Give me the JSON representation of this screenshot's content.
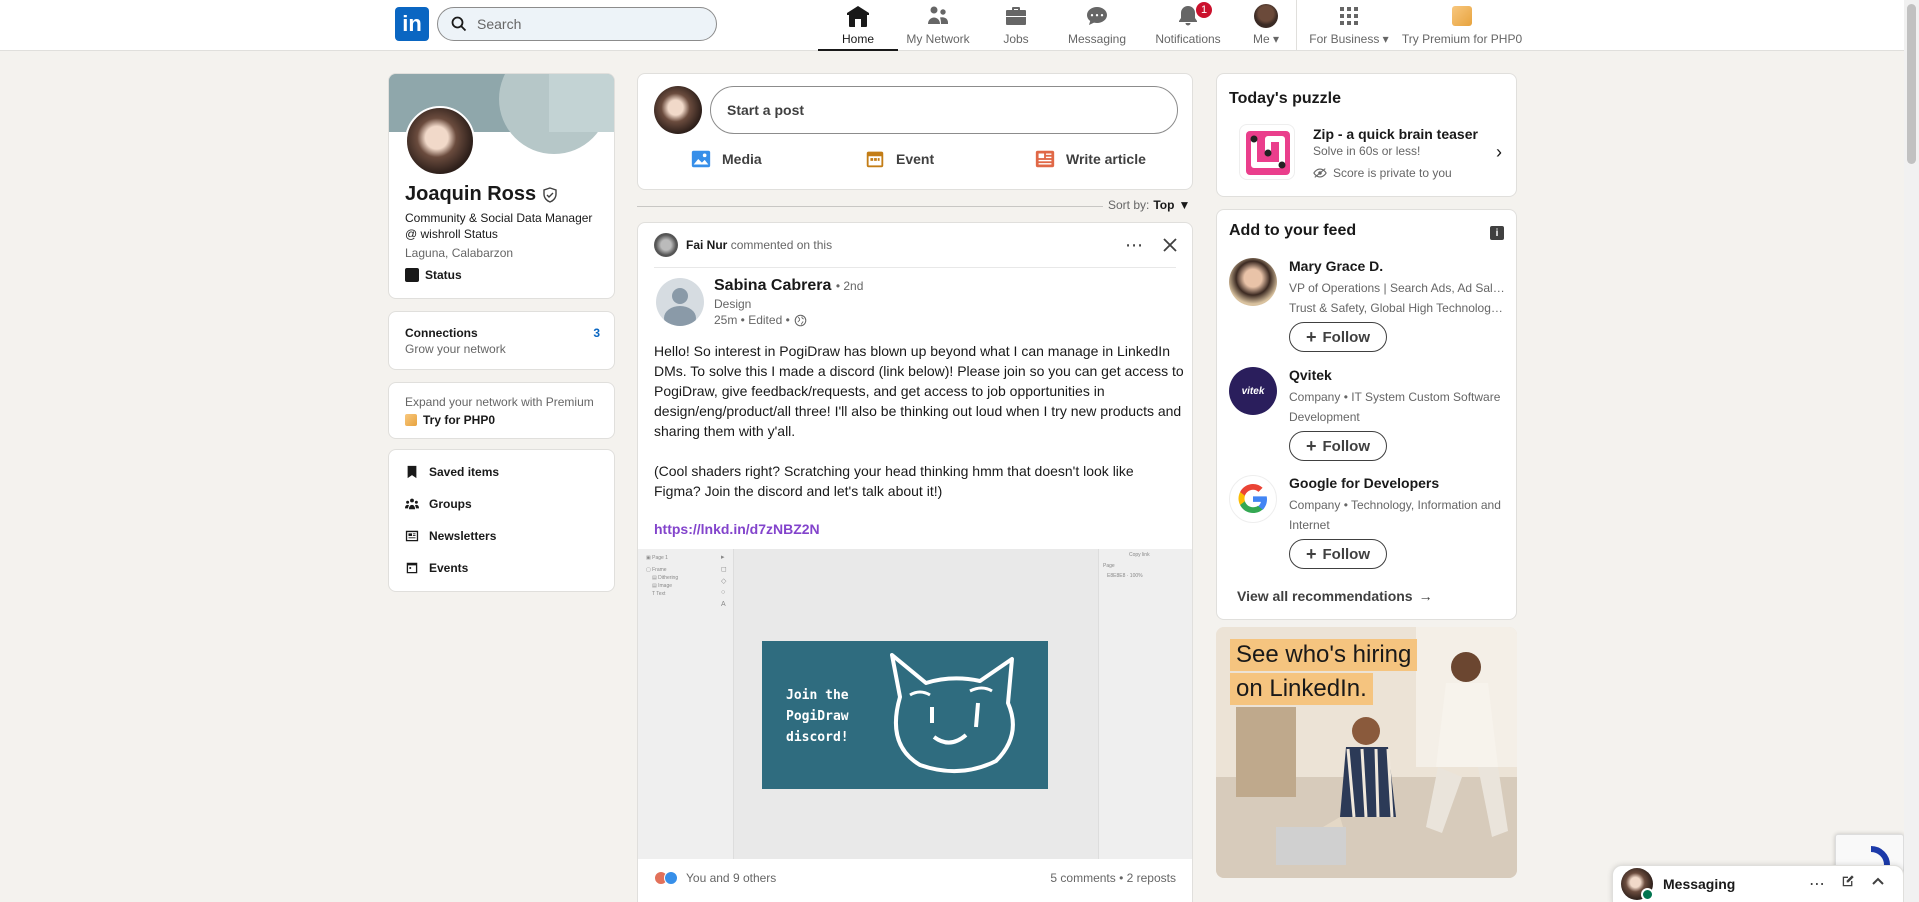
{
  "nav": {
    "logo": "in",
    "search_placeholder": "Search",
    "items": [
      {
        "label": "Home",
        "icon": "home-icon",
        "active": true
      },
      {
        "label": "My Network",
        "icon": "network-icon"
      },
      {
        "label": "Jobs",
        "icon": "briefcase-icon"
      },
      {
        "label": "Messaging",
        "icon": "messaging-icon"
      },
      {
        "label": "Notifications",
        "icon": "bell-icon",
        "badge": "1"
      },
      {
        "label": "Me",
        "icon": "avatar"
      },
      {
        "label": "For Business",
        "icon": "grid-icon"
      },
      {
        "label": "Try Premium for PHP0",
        "icon": "premium-icon"
      }
    ]
  },
  "profile": {
    "name": "Joaquin Ross",
    "headline": "Community & Social Data Manager @ wishroll Status",
    "location": "Laguna, Calabarzon",
    "status_label": "Status",
    "connections_label": "Connections",
    "connections_count": "3",
    "grow_network": "Grow your network",
    "premium_prompt": "Expand your network with Premium",
    "premium_cta": "Try for PHP0",
    "links": [
      "Saved items",
      "Groups",
      "Newsletters",
      "Events"
    ]
  },
  "composer": {
    "placeholder": "Start a post",
    "actions": [
      "Media",
      "Event",
      "Write article"
    ]
  },
  "sort": {
    "label": "Sort by:",
    "value": "Top"
  },
  "post": {
    "activity_actor": "Fai Nur",
    "activity_text": "commented on this",
    "author_name": "Sabina Cabrera",
    "author_degree": "• 2nd",
    "author_title": "Design",
    "time": "25m • Edited •",
    "body_1": "Hello! So interest in PogiDraw has blown up beyond what I can manage in LinkedIn DMs. To solve this I made a discord (link below)! Please join so you can get access to PogiDraw, give feedback/requests, and get access to job opportunities in design/eng/product/all three! I'll also be thinking out loud when I try new products and sharing them with y'all.",
    "body_2": "(Cool shaders right? Scratching your head thinking hmm that doesn't look like Figma? Join the discord and let's talk about it!)",
    "link": "https://lnkd.in/d7zNBZ2N",
    "image_text_1": "Join the",
    "image_text_2": "PogiDraw",
    "image_text_3": "discord!",
    "reactions_text": "You and 9 others",
    "stats": "5 comments • 2 reposts"
  },
  "puzzle": {
    "section_title": "Today's puzzle",
    "name": "Zip - a quick brain teaser",
    "subtitle": "Solve in 60s or less!",
    "privacy": "Score is private to you"
  },
  "feed": {
    "section_title": "Add to your feed",
    "follow_label": "Follow",
    "recommendations": [
      {
        "name": "Mary Grace D.",
        "desc_1": "VP of Operations | Search Ads, Ad Sales,",
        "desc_2": "Trust & Safety, Global High Technology..."
      },
      {
        "name": "Qvitek",
        "desc_1": "Company • IT System Custom Software",
        "desc_2": "Development"
      },
      {
        "name": "Google for Developers",
        "desc_1": "Company • Technology, Information and",
        "desc_2": "Internet"
      }
    ],
    "view_all": "View all recommendations"
  },
  "ad": {
    "line_1": "See who's hiring",
    "line_2": "on LinkedIn."
  },
  "messaging": {
    "title": "Messaging"
  },
  "colors": {
    "brand": "#0a66c2",
    "background": "#f4f2ee",
    "link_purple": "#8344cc",
    "notification_red": "#cb112d"
  }
}
